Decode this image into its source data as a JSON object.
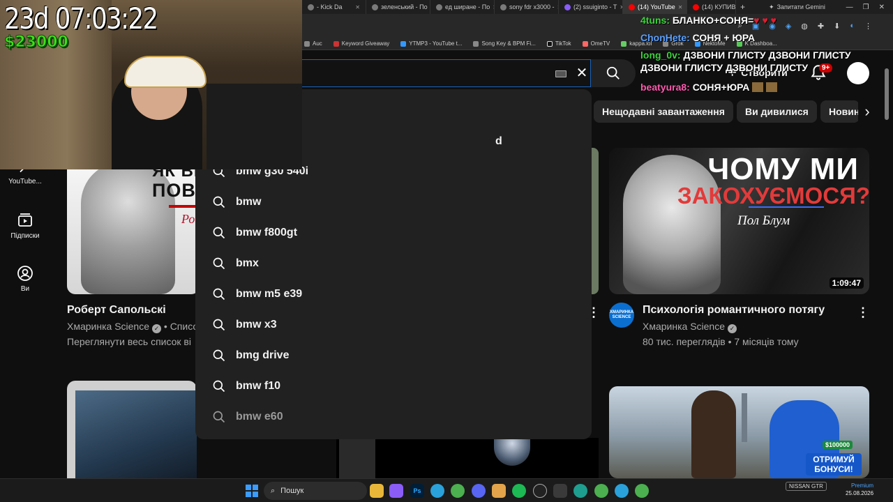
{
  "browser": {
    "tabs": [
      {
        "label": "- Kick Da"
      },
      {
        "label": "зеленський - По"
      },
      {
        "label": "ед ширане - По"
      },
      {
        "label": "sony fdr x3000 -"
      },
      {
        "label": "(2) ssuiginto - T"
      },
      {
        "label": "(14) YouTube",
        "active": true
      },
      {
        "label": "(14) КУПИВ С"
      }
    ],
    "gemini_label": "Запитати Gemini",
    "bookmarks": [
      "Auc",
      "Keyword Giveaway",
      "YTMP3 - YouTube t...",
      "Song Key & BPM Fi...",
      "TikTok",
      "OmeTV",
      "kappa.lol",
      "Grok",
      "NektoMe",
      "K Dashboa..."
    ]
  },
  "youtube": {
    "create_label": "Створити",
    "notification_badge": "9+",
    "chips": [
      "Нещодавні завантаження",
      "Ви дивилися",
      "Новин"
    ],
    "sidebar": [
      {
        "label": "YouTube...",
        "icon": "music-icon"
      },
      {
        "label": "Підписки",
        "icon": "subscriptions-icon"
      },
      {
        "label": "Ви",
        "icon": "you-icon"
      }
    ],
    "suggestions_partial_top": "d",
    "suggestions": [
      "bmw g30 540i",
      "bmw",
      "bmw f800gt",
      "bmx",
      "bmw m5 e39",
      "bmw x3",
      "bmg drive",
      "bmw f10",
      "bmw e60"
    ],
    "videos": [
      {
        "thumb_text_1": "ЯК ВІ",
        "thumb_text_2": "ПОВ",
        "thumb_signature": "Ро",
        "title": "Роберт Сапольскі",
        "channel": "Хмаринка Science",
        "channel_suffix": "• Списо",
        "meta": "Переглянути весь список ві"
      },
      {
        "thumb_text_1": "ЧОМУ МИ",
        "thumb_text_2": "ЗАКОХУЄМОСЯ?",
        "thumb_text_3": "Пол Блум",
        "duration": "1:09:47",
        "title": "Психологія романтичного потягу",
        "channel": "Хмаринка Science",
        "channel_avatar_text": "ХМАРИНКА SCIENCE",
        "meta": "80 тис. переглядів • 7 місяців тому"
      },
      {
        "cash_label": "$100000",
        "bonus_label": "ОТРИМУЙ БОНУСИ!"
      }
    ]
  },
  "stream": {
    "timer": "23d 07:03:22",
    "money": "$23000",
    "chat": [
      {
        "user": "4tuns:",
        "text": "БЛАНКО+СОНЯ=",
        "hearts": "♥ ♥ ♥"
      },
      {
        "user": "ChonHete:",
        "text": "СОНЯ + ЮРА"
      },
      {
        "user": "long_0v:",
        "text": "ДЗВОНИ ГЛИСТУ ДЗВОНИ ГЛИСТУ ДЗВОНИ ГЛИСТУ ДЗВОНИ ГЛИСТУ"
      },
      {
        "user": "beatyura8:",
        "text": "СОНЯ+ЮРА"
      }
    ]
  },
  "taskbar": {
    "search_label": "Пошук",
    "tray_label": "NISSAN GTR",
    "premium_label": "Premium",
    "date": "25.08.2026"
  }
}
